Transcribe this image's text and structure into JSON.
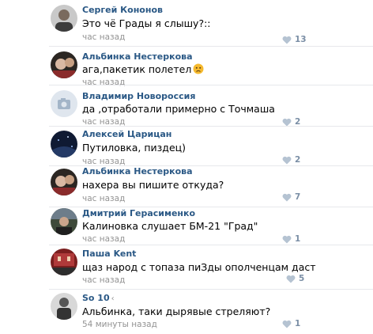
{
  "comments": [
    {
      "author": "Сергей Кононов",
      "text": "Это чё Грады я слышу?::",
      "time": "час назад",
      "likes": "13"
    },
    {
      "author": "Альбинка Нестеркова",
      "text": "ага,пакетик полетел",
      "time": "час назад",
      "likes": "",
      "emoji": "worried-face-emoji"
    },
    {
      "author": "Владимир Новороссия",
      "text": "да ,отработали примерно с Точмаша",
      "time": "час назад",
      "likes": "2"
    },
    {
      "author": "Алексей Царицан",
      "text": "Путиловка, пиздец)",
      "time": "час назад",
      "likes": "2"
    },
    {
      "author": "Альбинка Нестеркова",
      "text": "нахера вы пишите откуда?",
      "time": "час назад",
      "likes": "7"
    },
    {
      "author": "Дмитрий Герасименко",
      "text": "Калиновка слушает БМ-21 \"Град\"",
      "time": "час назад",
      "likes": "1"
    },
    {
      "author": "Паша Kent",
      "text": "щаз народ с топаза пиЗды ополченцам даст",
      "time": "час назад",
      "likes": "5"
    },
    {
      "author": "So 10",
      "author_suffix": "‹",
      "text": "Альбинка, таки дырявые стреляют?",
      "time": "54 минуты назад",
      "likes": "1"
    }
  ],
  "colors": {
    "name": "#2a5885",
    "meta": "#939393",
    "like": "#7a8ea5",
    "separator": "#e7e8ec"
  }
}
